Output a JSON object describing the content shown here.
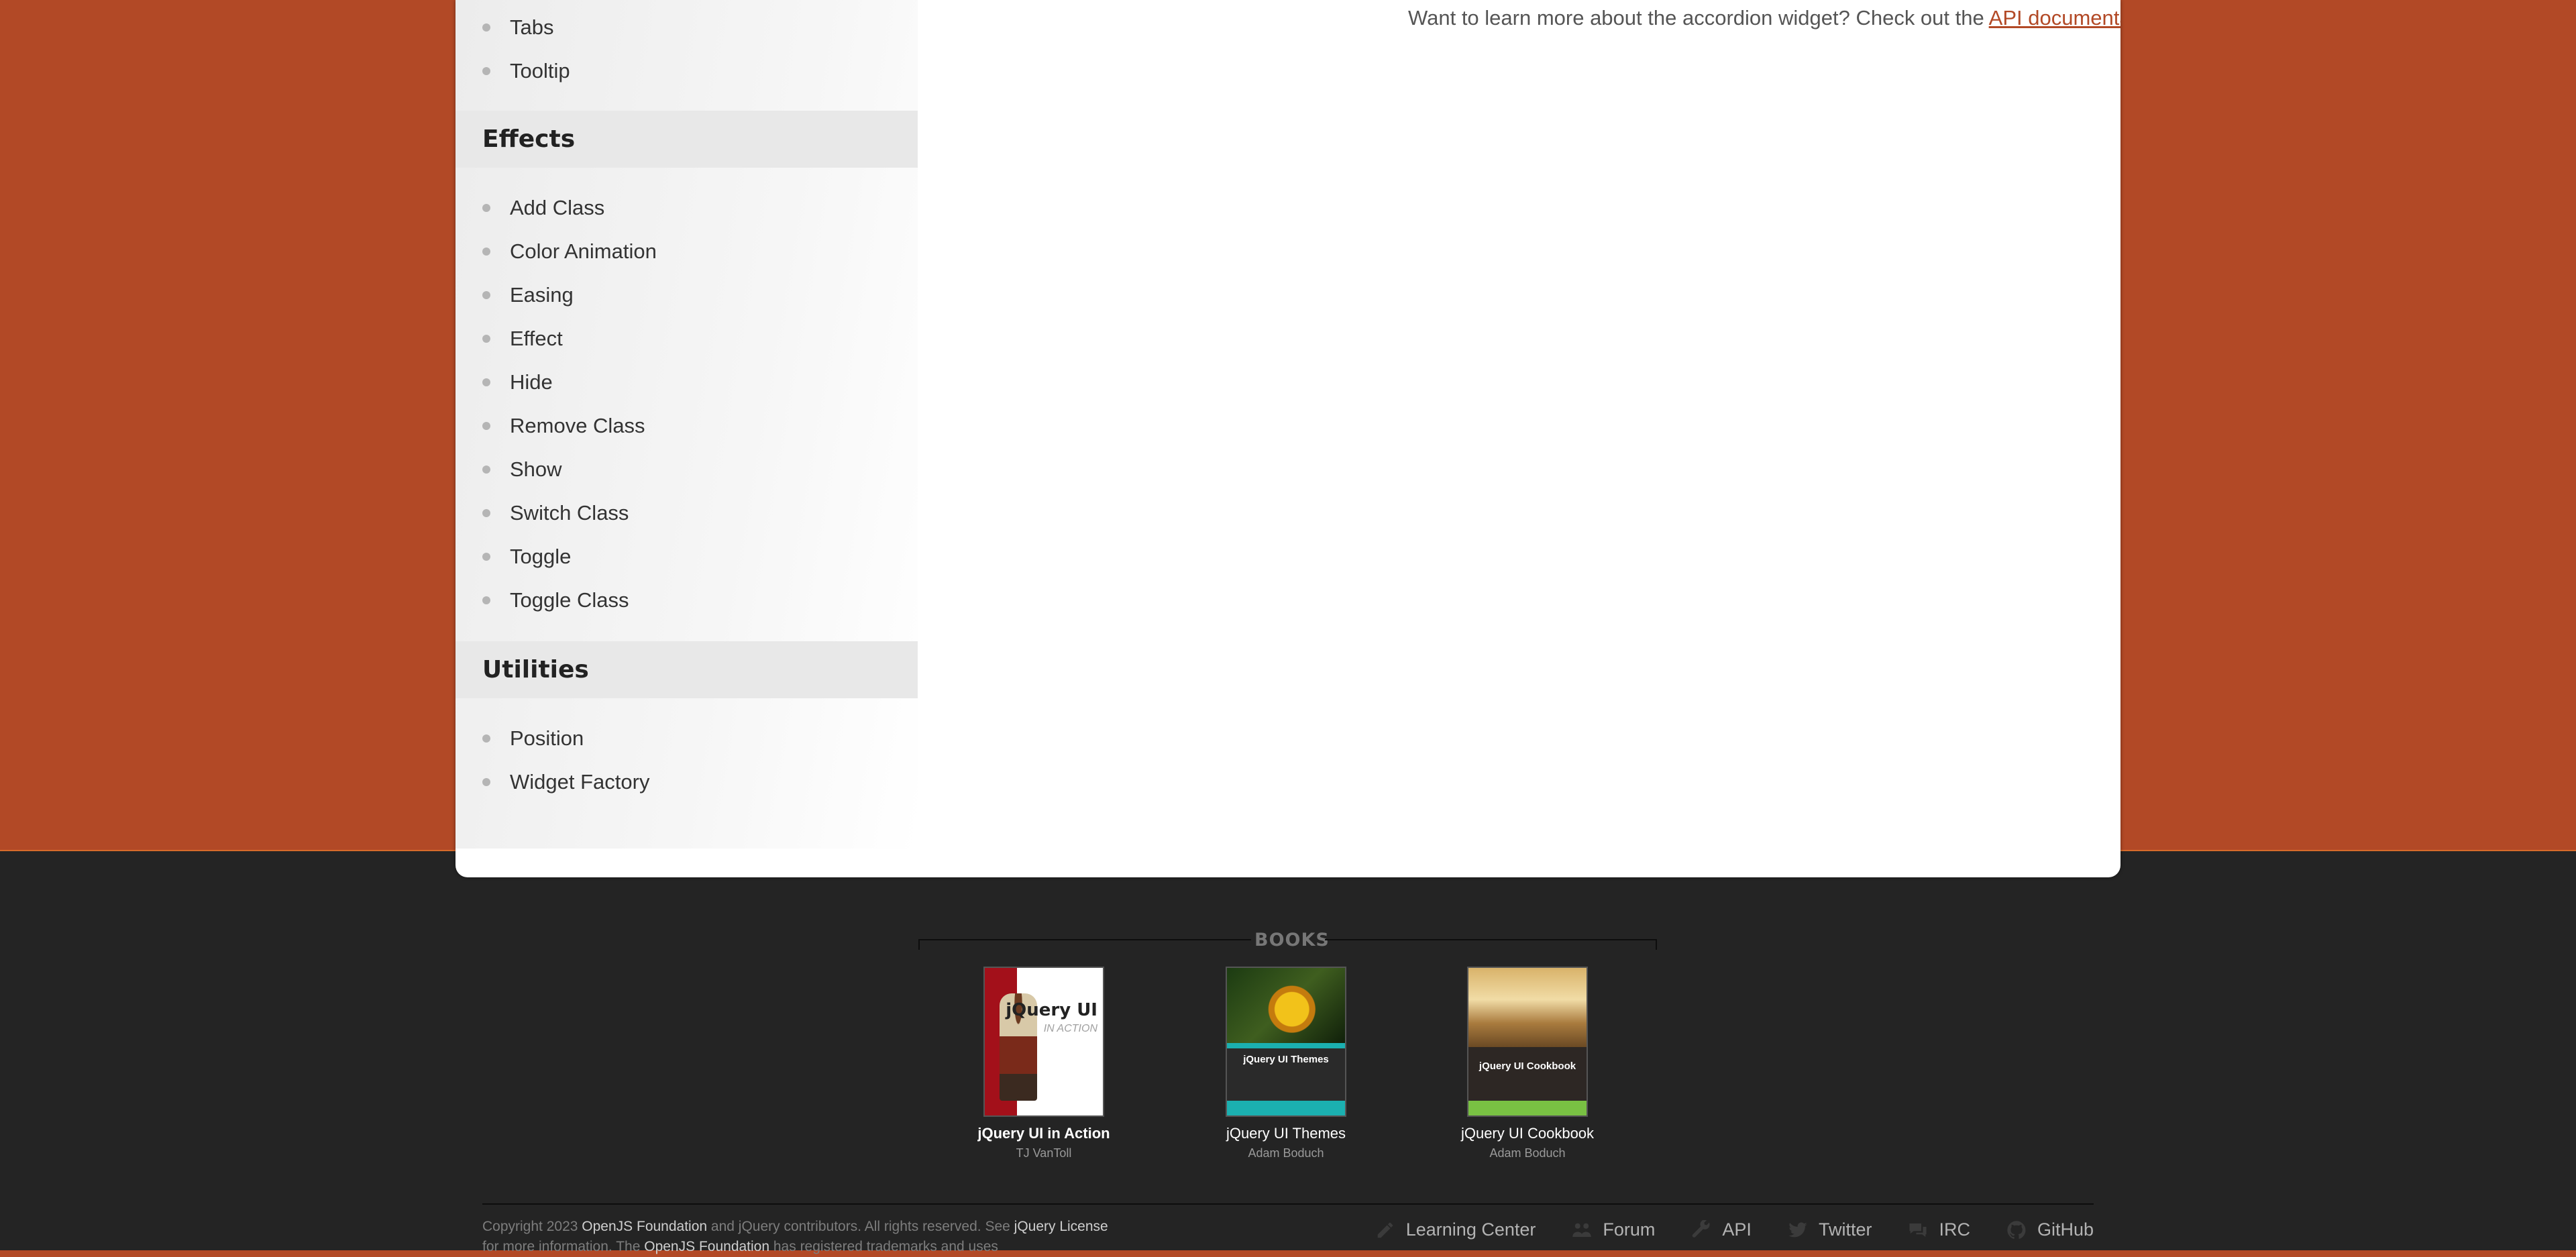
{
  "sidebar": {
    "widgets_tail": [
      {
        "label": "Tabs"
      },
      {
        "label": "Tooltip"
      }
    ],
    "effects": {
      "title": "Effects",
      "items": [
        {
          "label": "Add Class"
        },
        {
          "label": "Color Animation"
        },
        {
          "label": "Easing"
        },
        {
          "label": "Effect"
        },
        {
          "label": "Hide"
        },
        {
          "label": "Remove Class"
        },
        {
          "label": "Show"
        },
        {
          "label": "Switch Class"
        },
        {
          "label": "Toggle"
        },
        {
          "label": "Toggle Class"
        }
      ]
    },
    "utilities": {
      "title": "Utilities",
      "items": [
        {
          "label": "Position"
        },
        {
          "label": "Widget Factory"
        }
      ]
    }
  },
  "main": {
    "learn_more_text": "Want to learn more about the accordion widget? Check out the",
    "learn_more_link": "API documentation"
  },
  "books": {
    "title": "BOOKS",
    "items": [
      {
        "title": "jQuery UI in Action",
        "author": "TJ VanToll",
        "cover_title": "jQuery UI",
        "cover_subtitle": "IN ACTION"
      },
      {
        "title": "jQuery UI Themes",
        "author": "Adam Boduch",
        "cover_title": "jQuery UI Themes"
      },
      {
        "title": "jQuery UI Cookbook",
        "author": "Adam Boduch",
        "cover_title": "jQuery UI Cookbook"
      }
    ]
  },
  "footer": {
    "copyright_prefix": "Copyright 2023",
    "openjs_link": "OpenJS Foundation",
    "copyright_mid": "and jQuery contributors. All rights reserved. See",
    "license_link": "jQuery License",
    "copyright_mid2": "for more information. The",
    "openjs_link2": "OpenJS Foundation",
    "copyright_tail": "has registered trademarks and uses",
    "links": [
      {
        "label": "Learning Center",
        "icon": "pencil-icon"
      },
      {
        "label": "Forum",
        "icon": "users-icon"
      },
      {
        "label": "API",
        "icon": "wrench-icon"
      },
      {
        "label": "Twitter",
        "icon": "twitter-icon"
      },
      {
        "label": "IRC",
        "icon": "chat-icon"
      },
      {
        "label": "GitHub",
        "icon": "github-icon"
      }
    ]
  },
  "colors": {
    "brand": "#b24926",
    "footer_bg": "#242424",
    "accent_line": "#d66a2b"
  }
}
